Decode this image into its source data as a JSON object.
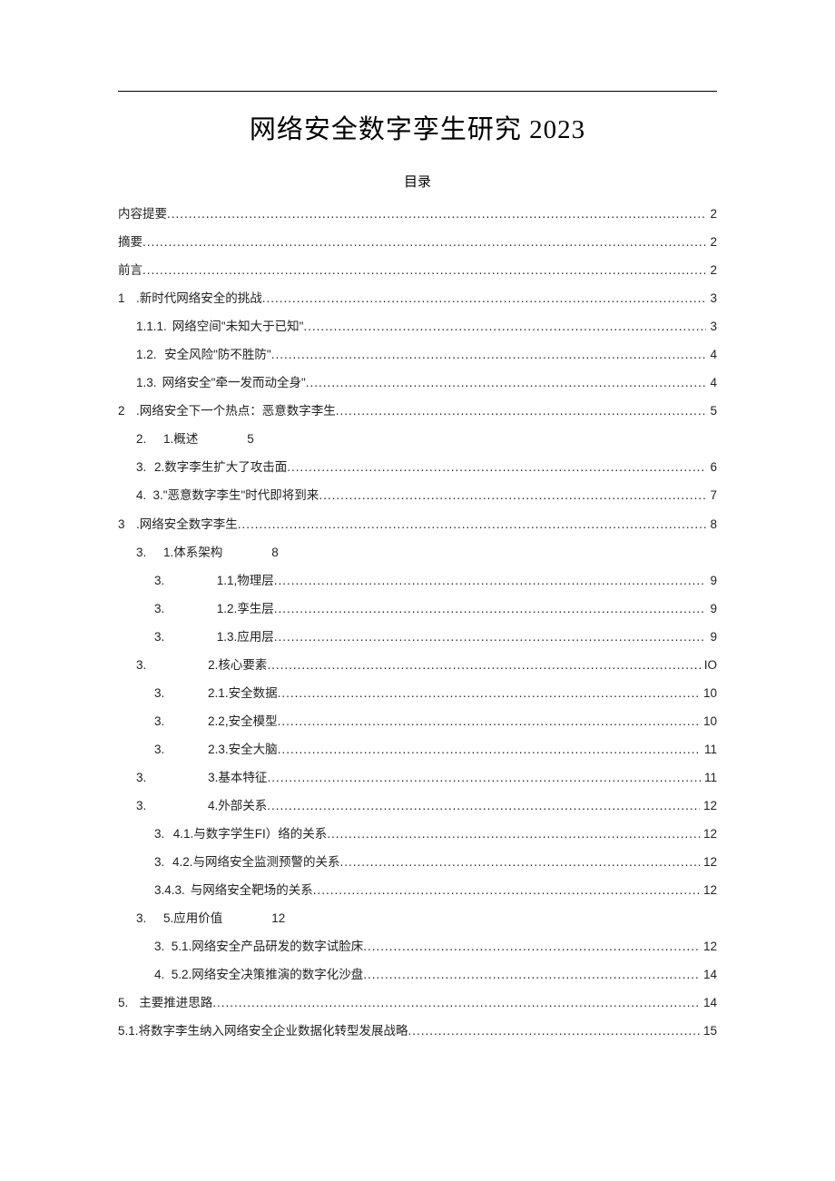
{
  "title": "网络安全数字孪生研究 2023",
  "toc_heading": "目录",
  "entries": {
    "e0": {
      "label": "内容提要",
      "page": "2"
    },
    "e1": {
      "label": "摘要",
      "page": "2"
    },
    "e2": {
      "label": "前言",
      "page": "2"
    },
    "e3": {
      "num": "1",
      "label": ".新时代网络安全的挑战",
      "page": "3"
    },
    "e4": {
      "num": "1.1.1.",
      "label": "网络空间\"未知大于已知\"",
      "page": "3"
    },
    "e5": {
      "num": "1.2.",
      "label": "安全风险\"防不胜防\"",
      "page": "4"
    },
    "e6": {
      "num": "1.3.",
      "label": "网络安全\"牵一发而动全身\"",
      "page": "4"
    },
    "e7": {
      "num": "2",
      "label": ".网络安全下一个热点：恶意数字李生",
      "page": "5"
    },
    "e8": {
      "num": "2.",
      "sub": "1.概述",
      "page": "5"
    },
    "e9": {
      "num": "3.",
      "sub": "2.数字李生扩大了攻击面",
      "page": "6"
    },
    "e10": {
      "num": "4.",
      "sub": "3.\"恶意数字李生\"时代即将到来",
      "page": "7"
    },
    "e11": {
      "num": "3",
      "label": ".网络安全数字李生",
      "page": "8"
    },
    "e12": {
      "num": "3.",
      "sub": "1.体系架构",
      "page": "8"
    },
    "e13": {
      "num": "3.",
      "sub": "1.1,物理层",
      "page": "9"
    },
    "e14": {
      "num": "3.",
      "sub": "1.2.孪生层",
      "page": "9"
    },
    "e15": {
      "num": "3.",
      "sub": "1.3.应用层",
      "page": "9"
    },
    "e16": {
      "num": "3.",
      "sub": "2.核心要素",
      "page": "IO"
    },
    "e17": {
      "num": "3.",
      "sub": "2.1.安全数据",
      "page": "10"
    },
    "e18": {
      "num": "3.",
      "sub": "2.2,安全模型",
      "page": "10"
    },
    "e19": {
      "num": "3.",
      "sub": "2.3.安全大脑",
      "page": "11"
    },
    "e20": {
      "num": "3.",
      "sub": "3.基本特征",
      "page": "11"
    },
    "e21": {
      "num": "3.",
      "sub": "4.外部关系",
      "page": "12"
    },
    "e22": {
      "num": "3.",
      "sub": "4.1.与数字学生FI）络的关系",
      "page": "12"
    },
    "e23": {
      "num": "3.",
      "sub": "4.2.与网络安全监测预警的关系",
      "page": "12"
    },
    "e24": {
      "num": "3.4.3.",
      "sub": "与网络安全靶场的关系",
      "page": "12"
    },
    "e25": {
      "num": "3.",
      "mid": "5.应用价值",
      "page": "12"
    },
    "e26": {
      "num": "3.",
      "sub": "5.1.网络安全产品研发的数字试脸床",
      "page": "12"
    },
    "e27": {
      "num": "4.",
      "sub": "5.2.网络安全决策推演的数字化沙盘",
      "page": "14"
    },
    "e28": {
      "num": "5.",
      "label": "主要推进思路",
      "page": "14"
    },
    "e29": {
      "num": "5.1.",
      "label": "将数字李生纳入网络安全企业数据化转型发展战略",
      "page": "15"
    }
  }
}
